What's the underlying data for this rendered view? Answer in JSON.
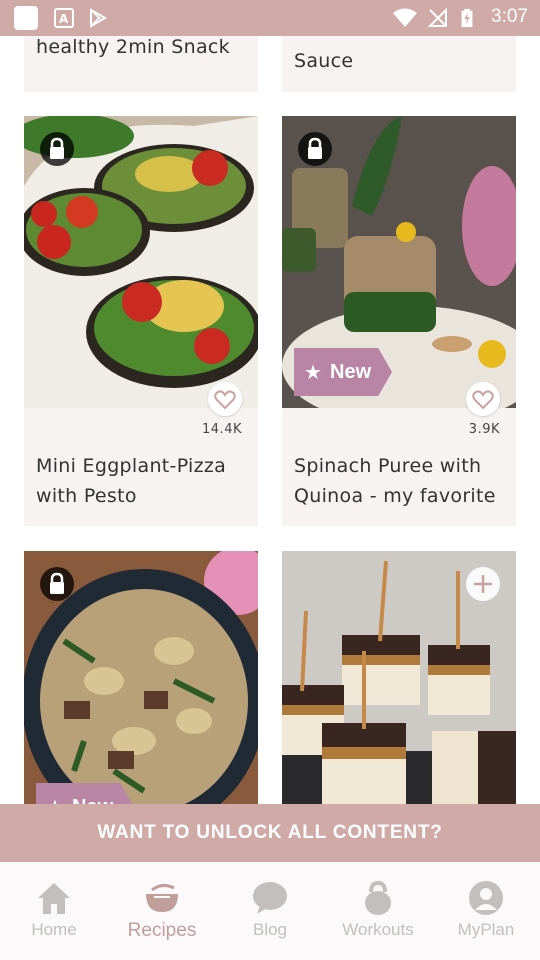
{
  "status_bar": {
    "time": "3:07"
  },
  "cards": [
    {
      "title": "healthy 2min Snack"
    },
    {
      "title": "Sauce"
    },
    {
      "title": "Mini Eggplant-Pizza with Pesto",
      "likes": "14.4K",
      "locked": true
    },
    {
      "title": "Spinach Puree with Quinoa - my favorite",
      "likes": "3.9K",
      "locked": true,
      "badge": "New"
    },
    {
      "title": "",
      "locked": true,
      "badge": "New"
    },
    {
      "title": "",
      "locked": false
    }
  ],
  "unlock_banner": {
    "label": "WANT TO UNLOCK ALL CONTENT?"
  },
  "tab_bar": {
    "tabs": [
      {
        "label": "Home",
        "icon": "home-icon"
      },
      {
        "label": "Recipes",
        "icon": "bowl-icon",
        "active": true
      },
      {
        "label": "Blog",
        "icon": "chat-bubble-icon"
      },
      {
        "label": "Workouts",
        "icon": "kettlebell-icon"
      },
      {
        "label": "MyPlan",
        "icon": "profile-icon"
      }
    ]
  },
  "colors": {
    "accent": "#cfaaa6",
    "badge": "#b985a5",
    "card_bg": "#f6f3f2",
    "tab_inactive": "#c3bfbf",
    "tab_active": "#c09f9b"
  }
}
